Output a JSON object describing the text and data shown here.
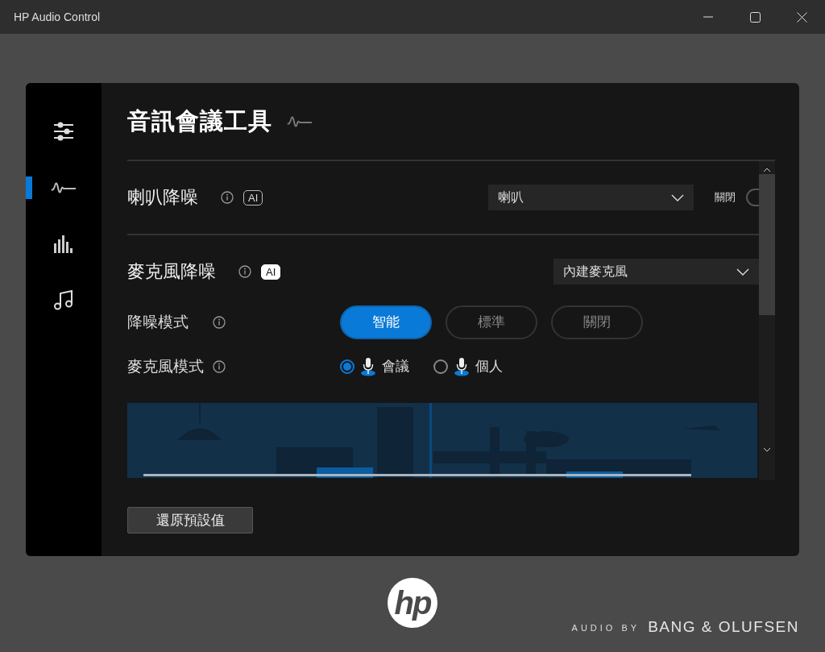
{
  "window": {
    "title": "HP Audio Control"
  },
  "sidebar": {
    "items": [
      {
        "kind": "sliders",
        "selected": false
      },
      {
        "kind": "wave",
        "selected": true
      },
      {
        "kind": "equalizer",
        "selected": false
      },
      {
        "kind": "music",
        "selected": false
      }
    ]
  },
  "page": {
    "title": "音訊會議工具"
  },
  "speaker_noise_reduction": {
    "label": "喇叭降噪",
    "badge": "AI",
    "badge_highlighted": false,
    "device": "喇叭",
    "switch_label": "關閉",
    "on": false
  },
  "mic_noise_reduction": {
    "label": "麥克風降噪",
    "badge": "AI",
    "badge_highlighted": true,
    "device": "內建麥克風",
    "mode_label": "降噪模式",
    "modes": [
      {
        "label": "智能",
        "selected": true
      },
      {
        "label": "標準",
        "selected": false
      },
      {
        "label": "關閉",
        "selected": false
      }
    ],
    "mic_mode_label": "麥克風模式",
    "mic_modes": [
      {
        "label": "會議",
        "selected": true
      },
      {
        "label": "個人",
        "selected": false
      }
    ]
  },
  "reset_button": "還原預設值",
  "footer": {
    "logo": "hp",
    "tagline": "AUDIO BY",
    "brand": "BANG & OLUFSEN"
  }
}
